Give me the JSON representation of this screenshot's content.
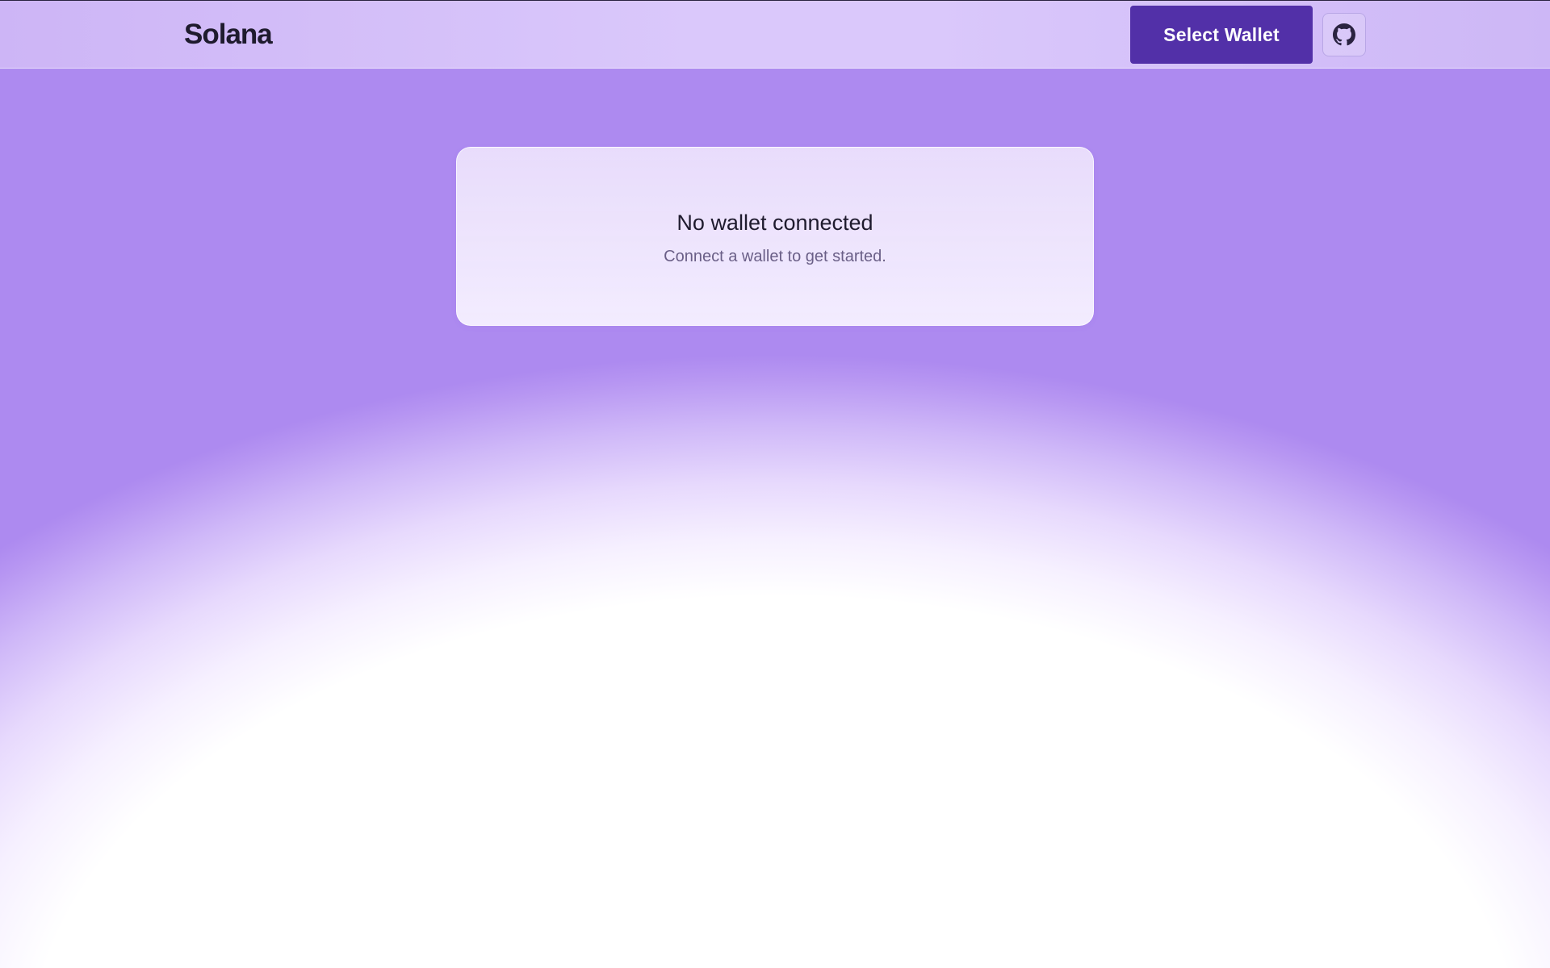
{
  "header": {
    "brand": "Solana",
    "select_wallet_label": "Select Wallet",
    "github_icon": "github-icon"
  },
  "card": {
    "title": "No wallet connected",
    "subtitle": "Connect a wallet to get started."
  },
  "colors": {
    "accent": "#5230a8",
    "text_primary": "#1f1b2e",
    "text_secondary": "#6a5f87",
    "gradient_purple": "#ad8af0",
    "header_bg": "#dac8fb"
  }
}
